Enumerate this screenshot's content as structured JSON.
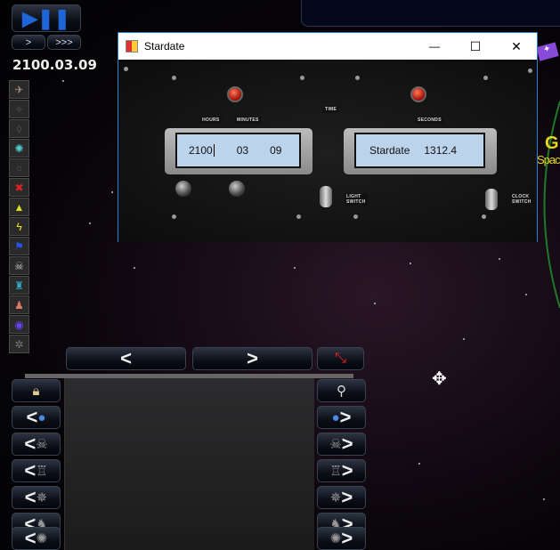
{
  "game": {
    "speed_buttons": {
      "normal": ">",
      "fast": ">>>"
    },
    "current_date": "2100.03.09",
    "sidebar_icons": [
      "planet-icon",
      "probe-icon",
      "star-icon",
      "crystal-icon",
      "station-icon",
      "nebula-icon",
      "red-cross-icon",
      "chevrons-icon",
      "lightning-icon",
      "flag-icon",
      "skull-ship-icon",
      "rocket-ship-icon",
      "robot-icon",
      "galaxy-icon",
      "gear-icon"
    ],
    "nav": {
      "prev": "<",
      "next": ">"
    },
    "partial_label_title": "G",
    "partial_label_subtitle": "Spac",
    "side_rows": [
      "globe-icon",
      "alien-ship-icon",
      "tower-ship-icon",
      "spider-ship-icon",
      "warrior-ship-icon",
      "crab-ship-icon"
    ],
    "row_arrows": {
      "left": "<",
      "right": ">"
    }
  },
  "window": {
    "title": "Stardate",
    "controls": {
      "minimize": "—",
      "maximize": "☐",
      "close": "✕"
    },
    "panel_labels": {
      "hours": "HOURS",
      "minutes": "MINUTES",
      "time": "TIME",
      "seconds": "SECONDS",
      "light_switch": "LIGHT SWITCH",
      "clock_switch": "CLOCK SWITCH"
    },
    "date_display": {
      "year": "2100",
      "month": "03",
      "day": "09"
    },
    "stardate_display": {
      "label": "Stardate",
      "value": "1312.4"
    }
  },
  "colors": {
    "window_border": "#2b7bd0",
    "lcd": "#bcd3ec",
    "accent_yellow": "#e6d619",
    "orbit": "#1e7a2a"
  }
}
